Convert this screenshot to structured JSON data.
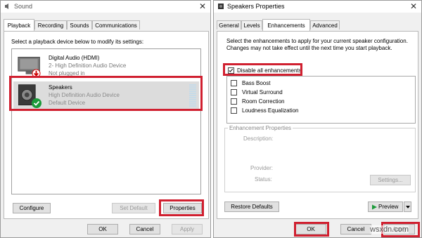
{
  "sound": {
    "title": "Sound",
    "close": "✕",
    "tabs": [
      "Playback",
      "Recording",
      "Sounds",
      "Communications"
    ],
    "instruction": "Select a playback device below to modify its settings:",
    "devices": [
      {
        "name": "Digital Audio (HDMI)",
        "line2": "2- High Definition Audio Device",
        "line3": "Not plugged in"
      },
      {
        "name": "Speakers",
        "line2": "High Definition Audio Device",
        "line3": "Default Device"
      }
    ],
    "configure": "Configure",
    "set_default": "Set Default",
    "properties": "Properties",
    "ok": "OK",
    "cancel": "Cancel",
    "apply": "Apply"
  },
  "speakers": {
    "title": "Speakers Properties",
    "close": "✕",
    "tabs": [
      "General",
      "Levels",
      "Enhancements",
      "Advanced"
    ],
    "desc": "Select the enhancements to apply for your current speaker configuration. Changes may not take effect until the next time you start playback.",
    "disable_all": "Disable all enhancements",
    "enhancements": [
      "Bass Boost",
      "Virtual Surround",
      "Room Correction",
      "Loudness Equalization"
    ],
    "group_title": "Enhancement Properties",
    "description_label": "Description:",
    "provider_label": "Provider:",
    "status_label": "Status:",
    "settings": "Settings...",
    "restore": "Restore Defaults",
    "preview": "Preview",
    "ok": "OK",
    "cancel": "Cancel",
    "apply": "Apply",
    "watermark": "wsxdn.com"
  }
}
